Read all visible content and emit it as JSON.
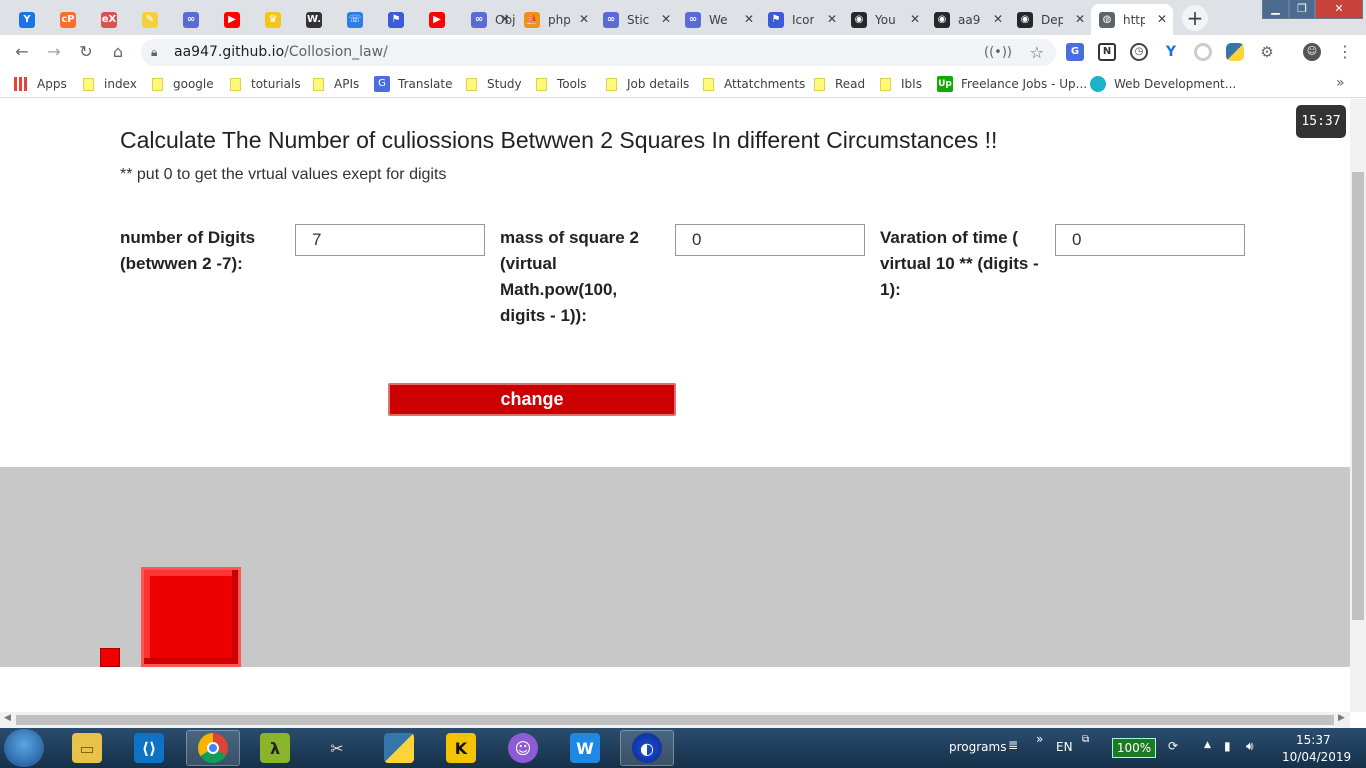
{
  "tabs": [
    {
      "title": "",
      "icon": "yandex-icon",
      "color": "#1a73e8",
      "glyph": "Y"
    },
    {
      "title": "",
      "icon": "cpanel-icon",
      "color": "#ff6c2c",
      "glyph": "cP"
    },
    {
      "title": "",
      "icon": "edx-icon",
      "color": "#d9534f",
      "glyph": "eX"
    },
    {
      "title": "",
      "icon": "note-icon",
      "color": "#f4d03f",
      "glyph": "✎"
    },
    {
      "title": "",
      "icon": "link-icon",
      "color": "#5b6bd6",
      "glyph": "∞"
    },
    {
      "title": "",
      "icon": "youtube-icon",
      "color": "#ff0000",
      "glyph": "▶"
    },
    {
      "title": "",
      "icon": "crown-icon",
      "color": "#f5c518",
      "glyph": "♛"
    },
    {
      "title": "",
      "icon": "wikipedia-icon",
      "color": "#333333",
      "glyph": "W."
    },
    {
      "title": "",
      "icon": "phone-icon",
      "color": "#2b7de9",
      "glyph": "☏"
    },
    {
      "title": "",
      "icon": "flag-icon",
      "color": "#3b5bdb",
      "glyph": "⚑"
    },
    {
      "title": "",
      "icon": "youtube-icon",
      "color": "#ff0000",
      "glyph": "▶"
    },
    {
      "title": "Obj",
      "icon": "link-icon",
      "color": "#5b6bd6",
      "glyph": "∞"
    },
    {
      "title": "php",
      "icon": "pma-icon",
      "color": "#f29111",
      "glyph": "⛵"
    },
    {
      "title": "Stic",
      "icon": "link-icon",
      "color": "#5b6bd6",
      "glyph": "∞"
    },
    {
      "title": "We",
      "icon": "link-icon",
      "color": "#5b6bd6",
      "glyph": "∞"
    },
    {
      "title": "Icor",
      "icon": "flag-icon",
      "color": "#3b5bdb",
      "glyph": "⚑"
    },
    {
      "title": "You",
      "icon": "github-icon",
      "color": "#24292e",
      "glyph": "◉"
    },
    {
      "title": "aa9",
      "icon": "github-icon",
      "color": "#24292e",
      "glyph": "◉"
    },
    {
      "title": "Dep",
      "icon": "github-icon",
      "color": "#24292e",
      "glyph": "◉"
    },
    {
      "title": "http",
      "icon": "globe-icon",
      "color": "#5f6368",
      "glyph": "◍"
    }
  ],
  "url": {
    "host": "aa947.github.io",
    "path": "/Collosion_law/"
  },
  "bookmarks": [
    {
      "label": "Apps",
      "icon": "apps-icon"
    },
    {
      "label": "index",
      "icon": "folder-icon"
    },
    {
      "label": "google",
      "icon": "folder-icon"
    },
    {
      "label": "toturials",
      "icon": "folder-icon"
    },
    {
      "label": "APIs",
      "icon": "folder-icon"
    },
    {
      "label": "Translate",
      "icon": "translate-icon"
    },
    {
      "label": "Study",
      "icon": "folder-icon"
    },
    {
      "label": "Tools",
      "icon": "folder-icon"
    },
    {
      "label": "Job details",
      "icon": "folder-icon"
    },
    {
      "label": "Attatchments",
      "icon": "folder-icon"
    },
    {
      "label": "Read",
      "icon": "folder-icon"
    },
    {
      "label": "IbIs",
      "icon": "folder-icon"
    },
    {
      "label": "Freelance Jobs - Up...",
      "icon": "upwork-icon"
    },
    {
      "label": "Web Development...",
      "icon": "webdev-icon"
    }
  ],
  "page": {
    "title": "Calculate The Number of culiossions Betwwen 2 Squares In different Circumstances !!",
    "subtitle": "** put 0 to get the vrtual values exept for digits",
    "fields": [
      {
        "label": "number of Digits (betwwen 2 -7):",
        "value": "7"
      },
      {
        "label": "mass of square 2 (virtual Math.pow(100, digits - 1)):",
        "value": "0"
      },
      {
        "label": "Varation of time ( virtual 10 ** (digits - 1):",
        "value": "0"
      }
    ],
    "button": "change",
    "clock": "15:37"
  },
  "taskbar": {
    "programs": "programs",
    "lang": "EN",
    "battery": "100%",
    "time": "15:37",
    "date": "10/04/2019"
  }
}
